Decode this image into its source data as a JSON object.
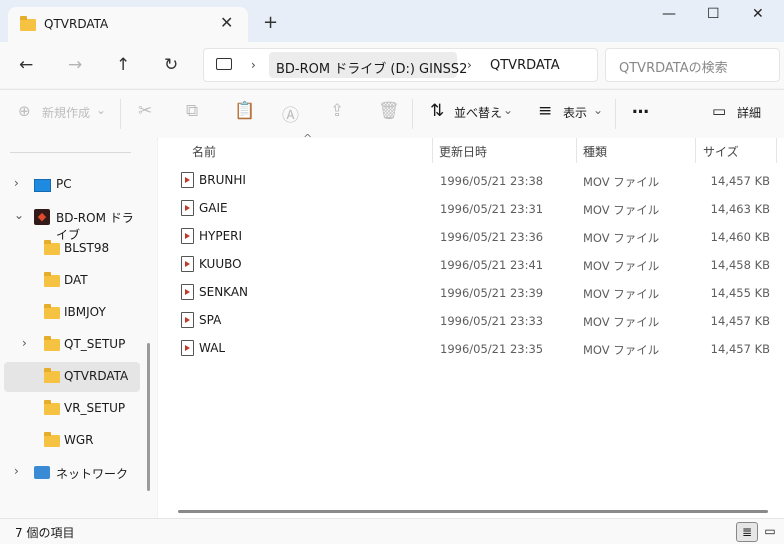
{
  "window": {
    "tab_title": "QTVRDATA",
    "tab_close": "✕",
    "new_tab": "+",
    "minimize": "—",
    "maximize": "☐",
    "close": "✕"
  },
  "nav": {
    "back": "←",
    "forward": "→",
    "up": "↑",
    "refresh": "↻",
    "computer_icon": "computer-icon",
    "breadcrumb": [
      "BD-ROM ドライブ (D:) GINSS2",
      "QTVRDATA"
    ],
    "separator": "›",
    "search_placeholder": "QTVRDATAの検索"
  },
  "toolbar": {
    "new_label": "新規作成",
    "sort_label": "並べ替え",
    "view_label": "表示",
    "more_label": "…",
    "details_label": "詳細",
    "plus": "⊕",
    "sort_icon": "⇅",
    "view_icon": "≡",
    "details_icon": "▭",
    "chevron": "⌄"
  },
  "sidebar": {
    "items": [
      {
        "label": "PC",
        "icon": "pc-icon",
        "chevron": "›",
        "selected": false
      },
      {
        "label": "BD-ROM ドライブ",
        "icon": "drive-icon",
        "chevron": "⌄",
        "selected": false
      },
      {
        "label": "BLST98",
        "icon": "folder-icon",
        "chevron": "",
        "selected": false
      },
      {
        "label": "DAT",
        "icon": "folder-icon",
        "chevron": "",
        "selected": false
      },
      {
        "label": "IBMJOY",
        "icon": "folder-icon",
        "chevron": "",
        "selected": false
      },
      {
        "label": "QT_SETUP",
        "icon": "folder-icon",
        "chevron": "›",
        "selected": false
      },
      {
        "label": "QTVRDATA",
        "icon": "folder-icon",
        "chevron": "",
        "selected": true
      },
      {
        "label": "VR_SETUP",
        "icon": "folder-icon",
        "chevron": "",
        "selected": false
      },
      {
        "label": "WGR",
        "icon": "folder-icon",
        "chevron": "",
        "selected": false
      },
      {
        "label": "ネットワーク",
        "icon": "network-icon",
        "chevron": "›",
        "selected": false
      }
    ]
  },
  "columns": {
    "name": "名前",
    "modified": "更新日時",
    "type": "種類",
    "size": "サイズ",
    "sort_indicator": "^"
  },
  "files": [
    {
      "name": "BRUNHI",
      "modified": "1996/05/21 23:38",
      "type": "MOV ファイル",
      "size": "14,457 KB"
    },
    {
      "name": "GAIE",
      "modified": "1996/05/21 23:31",
      "type": "MOV ファイル",
      "size": "14,463 KB"
    },
    {
      "name": "HYPERI",
      "modified": "1996/05/21 23:36",
      "type": "MOV ファイル",
      "size": "14,460 KB"
    },
    {
      "name": "KUUBO",
      "modified": "1996/05/21 23:41",
      "type": "MOV ファイル",
      "size": "14,458 KB"
    },
    {
      "name": "SENKAN",
      "modified": "1996/05/21 23:39",
      "type": "MOV ファイル",
      "size": "14,455 KB"
    },
    {
      "name": "SPA",
      "modified": "1996/05/21 23:33",
      "type": "MOV ファイル",
      "size": "14,457 KB"
    },
    {
      "name": "WAL",
      "modified": "1996/05/21 23:35",
      "type": "MOV ファイル",
      "size": "14,457 KB"
    }
  ],
  "status": {
    "item_count": "7 個の項目",
    "details_view_icon": "≣",
    "tiles_view_icon": "▭"
  }
}
